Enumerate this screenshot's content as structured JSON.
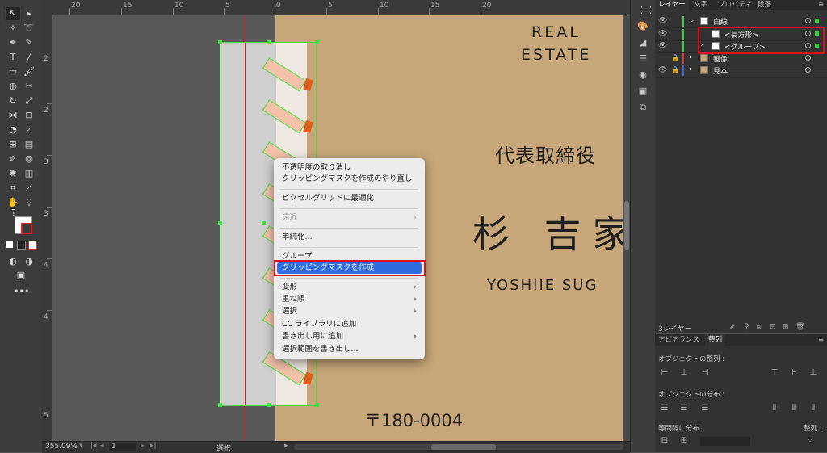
{
  "ruler_top": {
    "ticks": [
      "20",
      "15",
      "10",
      "5",
      "0",
      "5",
      "10",
      "15",
      "20"
    ]
  },
  "ruler_left": {
    "ticks": [
      "2",
      "2",
      "3",
      "3",
      "4",
      "4",
      "5"
    ]
  },
  "card": {
    "real": "REAL",
    "estate": "ESTATE",
    "title": "代表取締役",
    "name": "杉 吉家",
    "roman": "YOSHIIE SUG",
    "zip": "〒180-0004"
  },
  "context_menu": {
    "items": [
      {
        "label": "不透明度の取り消し"
      },
      {
        "label": "クリッピングマスクを作成のやり直し"
      },
      {
        "label": "ピクセルグリッドに最適化"
      },
      {
        "label": "遠近"
      },
      {
        "label": "単純化..."
      },
      {
        "label": "グループ"
      },
      {
        "label": "クリッピングマスクを作成"
      },
      {
        "label": "変形"
      },
      {
        "label": "重ね順"
      },
      {
        "label": "選択"
      },
      {
        "label": "CC ライブラリに追加"
      },
      {
        "label": "書き出し用に追加"
      },
      {
        "label": "選択範囲を書き出し..."
      }
    ],
    "submenu_arrow": "›"
  },
  "status": {
    "zoom": "355.09%",
    "page": "1",
    "mode": "選択"
  },
  "layers_panel": {
    "tabs": [
      "レイヤー",
      "文字",
      "プロパティ",
      "段落"
    ],
    "rows": [
      {
        "name": "白線"
      },
      {
        "name": "<長方形>"
      },
      {
        "name": "<グループ>"
      },
      {
        "name": "画像"
      },
      {
        "name": "見本"
      }
    ],
    "colors": {
      "green": "#35d035",
      "red": "#e03030",
      "blue": "#3a5ee0"
    },
    "count": "3レイヤー"
  },
  "align_panel": {
    "tabs": [
      "アピアランス",
      "整列"
    ],
    "align_objects": "オブジェクトの整列 :",
    "distribute_objects": "オブジェクトの分布 :",
    "distribute_spacing": "等間隔に分布 :",
    "align_to": "整列 :"
  },
  "colors": {
    "highlight": "#2d6de0",
    "callout": "#e0101a",
    "selection": "#3fe03f"
  }
}
